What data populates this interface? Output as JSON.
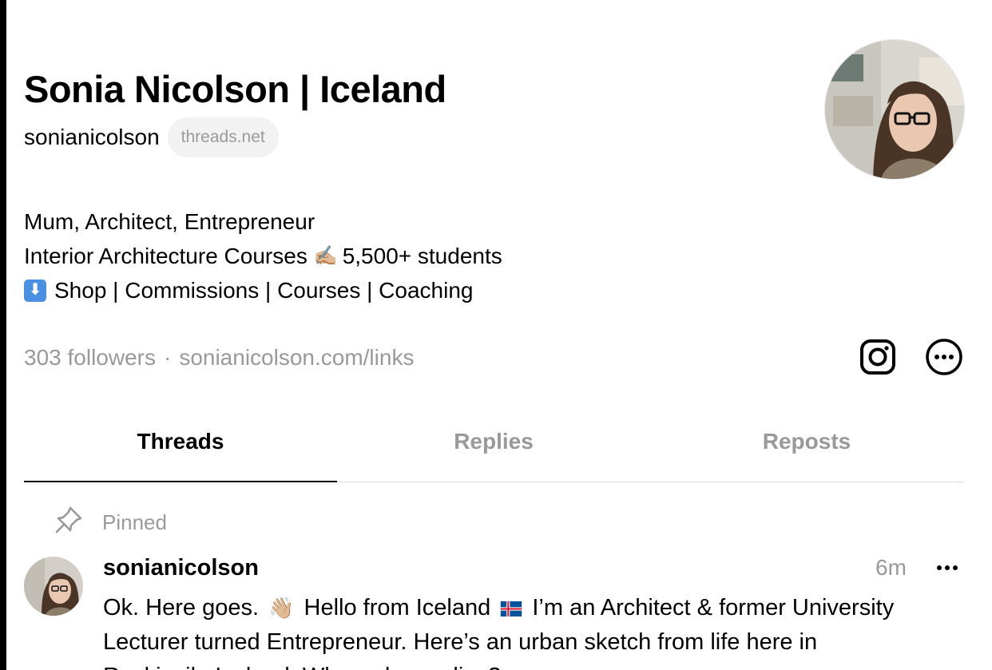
{
  "profile": {
    "name": "Sonia Nicolson | Iceland",
    "handle": "sonianicolson",
    "domain_badge": "threads.net",
    "bio": {
      "line1": "Mum, Architect, Entrepreneur",
      "line2_before": "Interior Architecture Courses",
      "line2_emoji": "✍🏼",
      "line2_after": "5,500+ students",
      "line3_icon": "⬇",
      "line3": "Shop | Commissions | Courses | Coaching"
    },
    "followers": "303 followers",
    "separator": "·",
    "link": "sonianicolson.com/links",
    "icons": {
      "instagram": "instagram-icon",
      "more": "more-circle-icon"
    }
  },
  "tabs": [
    {
      "label": "Threads",
      "active": true
    },
    {
      "label": "Replies",
      "active": false
    },
    {
      "label": "Reposts",
      "active": false
    }
  ],
  "pinned_label": "Pinned",
  "post": {
    "username": "sonianicolson",
    "time": "6m",
    "more": "···",
    "text_a": "Ok. Here goes.",
    "wave_emoji": "👋🏼",
    "text_b": "Hello from Iceland",
    "text_c": "I’m an Architect & former University",
    "line2": "Lecturer turned Entrepreneur. Here’s an urban sketch from life here in",
    "line3_partial": "Reykjavik, Iceland. Where do you live?"
  },
  "colors": {
    "muted": "#999999",
    "pill_bg": "#f2f2f2",
    "accent_blue": "#4a90e2"
  }
}
